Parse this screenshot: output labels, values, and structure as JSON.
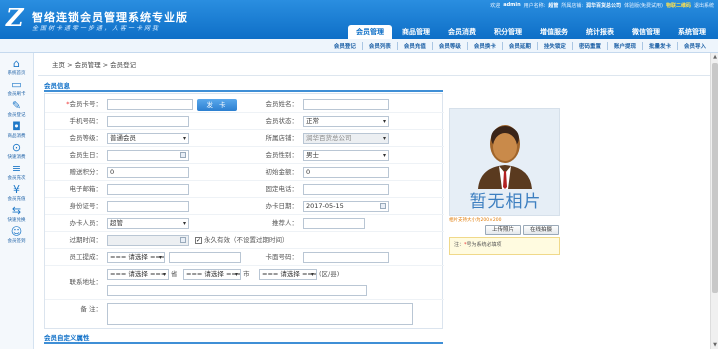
{
  "header": {
    "logo_letter": "Z",
    "title": "智络连锁会员管理系统专业版",
    "slogan": "全国树卡通零一步通，人客一卡网我",
    "welcome": "欢迎",
    "username": "admin",
    "user_name_label": "用户名称:",
    "user_name": "超管",
    "store_label": "所属店铺:",
    "store": "润华百货总公司",
    "trial_text": "体验版(免费试用)",
    "upgrade": "物联二维码",
    "logout": "退出系统"
  },
  "nav_tabs": [
    "会员管理",
    "商品管理",
    "会员消费",
    "积分管理",
    "增值服务",
    "统计报表",
    "微信管理",
    "系统管理"
  ],
  "active_nav": "会员管理",
  "subnav": [
    "会员登记",
    "会员列表",
    "会员充值",
    "会员等级",
    "会员换卡",
    "会员延期",
    "挂失锁定",
    "密码重置",
    "账户提现",
    "批量发卡",
    "会员导入"
  ],
  "sidebar": [
    {
      "label": "系统首页",
      "icon": "home-icon",
      "glyph": "⌂"
    },
    {
      "label": "会员刷卡",
      "icon": "card-swipe-icon",
      "glyph": "▭"
    },
    {
      "label": "会员登记",
      "icon": "edit-icon",
      "glyph": "✎"
    },
    {
      "label": "商品消费",
      "icon": "bag-icon",
      "glyph": "◘"
    },
    {
      "label": "快速消费",
      "icon": "lightning-icon",
      "glyph": "⊙"
    },
    {
      "label": "会员充次",
      "icon": "list-icon",
      "glyph": "≡"
    },
    {
      "label": "会员充值",
      "icon": "yen-icon",
      "glyph": "¥"
    },
    {
      "label": "快速兑换",
      "icon": "exchange-icon",
      "glyph": "⇆"
    },
    {
      "label": "会员签到",
      "icon": "user-group-icon",
      "glyph": "☺"
    }
  ],
  "breadcrumb": "主页 > 会员管理 > 会员登记",
  "section_title": "会员信息",
  "section2_title": "会员自定义属性",
  "form": {
    "card_no_label": "会员卡号：",
    "issue_card_button": "发 卡",
    "member_name_label": "会员姓名：",
    "phone_label": "手机号码：",
    "status_label": "会员状态：",
    "status_value": "正常",
    "level_label": "会员等级：",
    "level_value": "普通会员",
    "store_label": "所属店铺：",
    "store_value": "润华百货总公司",
    "birthday_label": "会员生日：",
    "gender_label": "会员性别：",
    "gender_value": "男士",
    "bonus_points_label": "赠送积分：",
    "bonus_points_value": "0",
    "initial_amount_label": "初始金额：",
    "initial_amount_value": "0",
    "email_label": "电子邮箱：",
    "landline_label": "固定电话：",
    "id_label": "身份证号：",
    "card_date_label": "办卡日期：",
    "card_date_value": "2017-05-15",
    "operator_label": "办卡人员：",
    "operator_value": "超管",
    "referrer_label": "推荐人：",
    "expire_label": "过期时间：",
    "permanent_text": "永久有效（不设置过期时间）",
    "staff_label": "员工提成：",
    "staff_value": "=== 请选择 ===",
    "card_password_label": "卡面号码：",
    "address_label": "联系地址：",
    "province_value": "=== 请选择 ===",
    "province_unit": "省",
    "city_value": "=== 请选择 ===",
    "city_unit": "市",
    "district_value": "=== 请选择 ===",
    "district_unit": "(区/县)",
    "remark_label": "备 注："
  },
  "photo": {
    "placeholder_text": "暂无相片",
    "hint": "相片支持大小为200×200",
    "upload_button": "上传照片",
    "capture_button": "在线拍摄"
  },
  "note": {
    "prefix": "注：",
    "star": "*",
    "text": "号为系统必填项"
  },
  "colors": {
    "header_blue": "#0e6fc7",
    "accent": "#3f8fd6",
    "highlight": "#ffe14d"
  }
}
